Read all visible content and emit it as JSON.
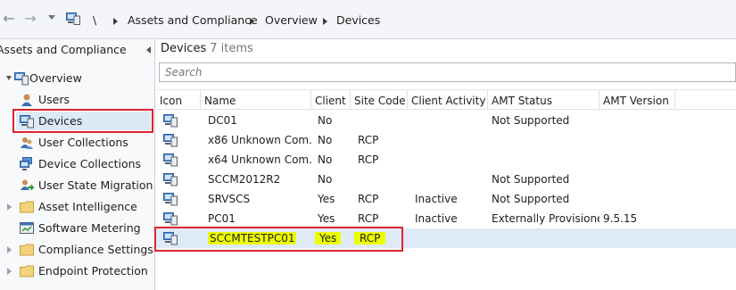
{
  "nav": {
    "breadcrumb": [
      "\\",
      "Assets and Compliance",
      "Overview",
      "Devices"
    ],
    "icons": {
      "back": "back-arrow-icon",
      "forward": "forward-arrow-icon",
      "dropdown": "dropdown-icon",
      "console": "console-icon"
    }
  },
  "sidebar": {
    "header": "Assets and Compliance",
    "items": [
      {
        "label": "Overview",
        "icon": "overview-icon",
        "twisty": "open"
      },
      {
        "label": "Users",
        "icon": "users-icon"
      },
      {
        "label": "Devices",
        "icon": "devices-icon",
        "selected": true
      },
      {
        "label": "User Collections",
        "icon": "user-collections-icon"
      },
      {
        "label": "Device Collections",
        "icon": "device-collections-icon"
      },
      {
        "label": "User State Migration",
        "icon": "user-state-migration-icon"
      },
      {
        "label": "Asset Intelligence",
        "icon": "folder-icon",
        "twisty": "closed"
      },
      {
        "label": "Software Metering",
        "icon": "software-metering-icon"
      },
      {
        "label": "Compliance Settings",
        "icon": "folder-icon",
        "twisty": "closed"
      },
      {
        "label": "Endpoint Protection",
        "icon": "folder-icon",
        "twisty": "closed"
      }
    ]
  },
  "main": {
    "title": "Devices",
    "count": "7 items",
    "search_placeholder": "Search",
    "columns": [
      "Icon",
      "Name",
      "Client",
      "Site Code",
      "Client Activity",
      "AMT Status",
      "AMT Version"
    ],
    "rows": [
      {
        "name": "DC01",
        "client": "No",
        "site_code": "",
        "client_activity": "",
        "amt_status": "Not Supported",
        "amt_version": ""
      },
      {
        "name": "x86 Unknown Com...",
        "client": "No",
        "site_code": "RCP",
        "client_activity": "",
        "amt_status": "",
        "amt_version": ""
      },
      {
        "name": "x64 Unknown Com...",
        "client": "No",
        "site_code": "RCP",
        "client_activity": "",
        "amt_status": "",
        "amt_version": ""
      },
      {
        "name": "SCCM2012R2",
        "client": "No",
        "site_code": "",
        "client_activity": "",
        "amt_status": "Not Supported",
        "amt_version": ""
      },
      {
        "name": "SRVSCS",
        "client": "Yes",
        "site_code": "RCP",
        "client_activity": "Inactive",
        "amt_status": "Not Supported",
        "amt_version": ""
      },
      {
        "name": "PC01",
        "client": "Yes",
        "site_code": "RCP",
        "client_activity": "Inactive",
        "amt_status": "Externally Provisioned",
        "amt_version": "9.5.15"
      },
      {
        "name": "SCCMTESTPC01",
        "client": "Yes",
        "site_code": "RCP",
        "client_activity": "",
        "amt_status": "",
        "amt_version": "",
        "selected": true,
        "highlighted": true
      }
    ]
  },
  "colors": {
    "annotation_red": "#e0242c",
    "highlight_yellow": "#ecff00",
    "selection_blue": "#dfeaf7"
  }
}
